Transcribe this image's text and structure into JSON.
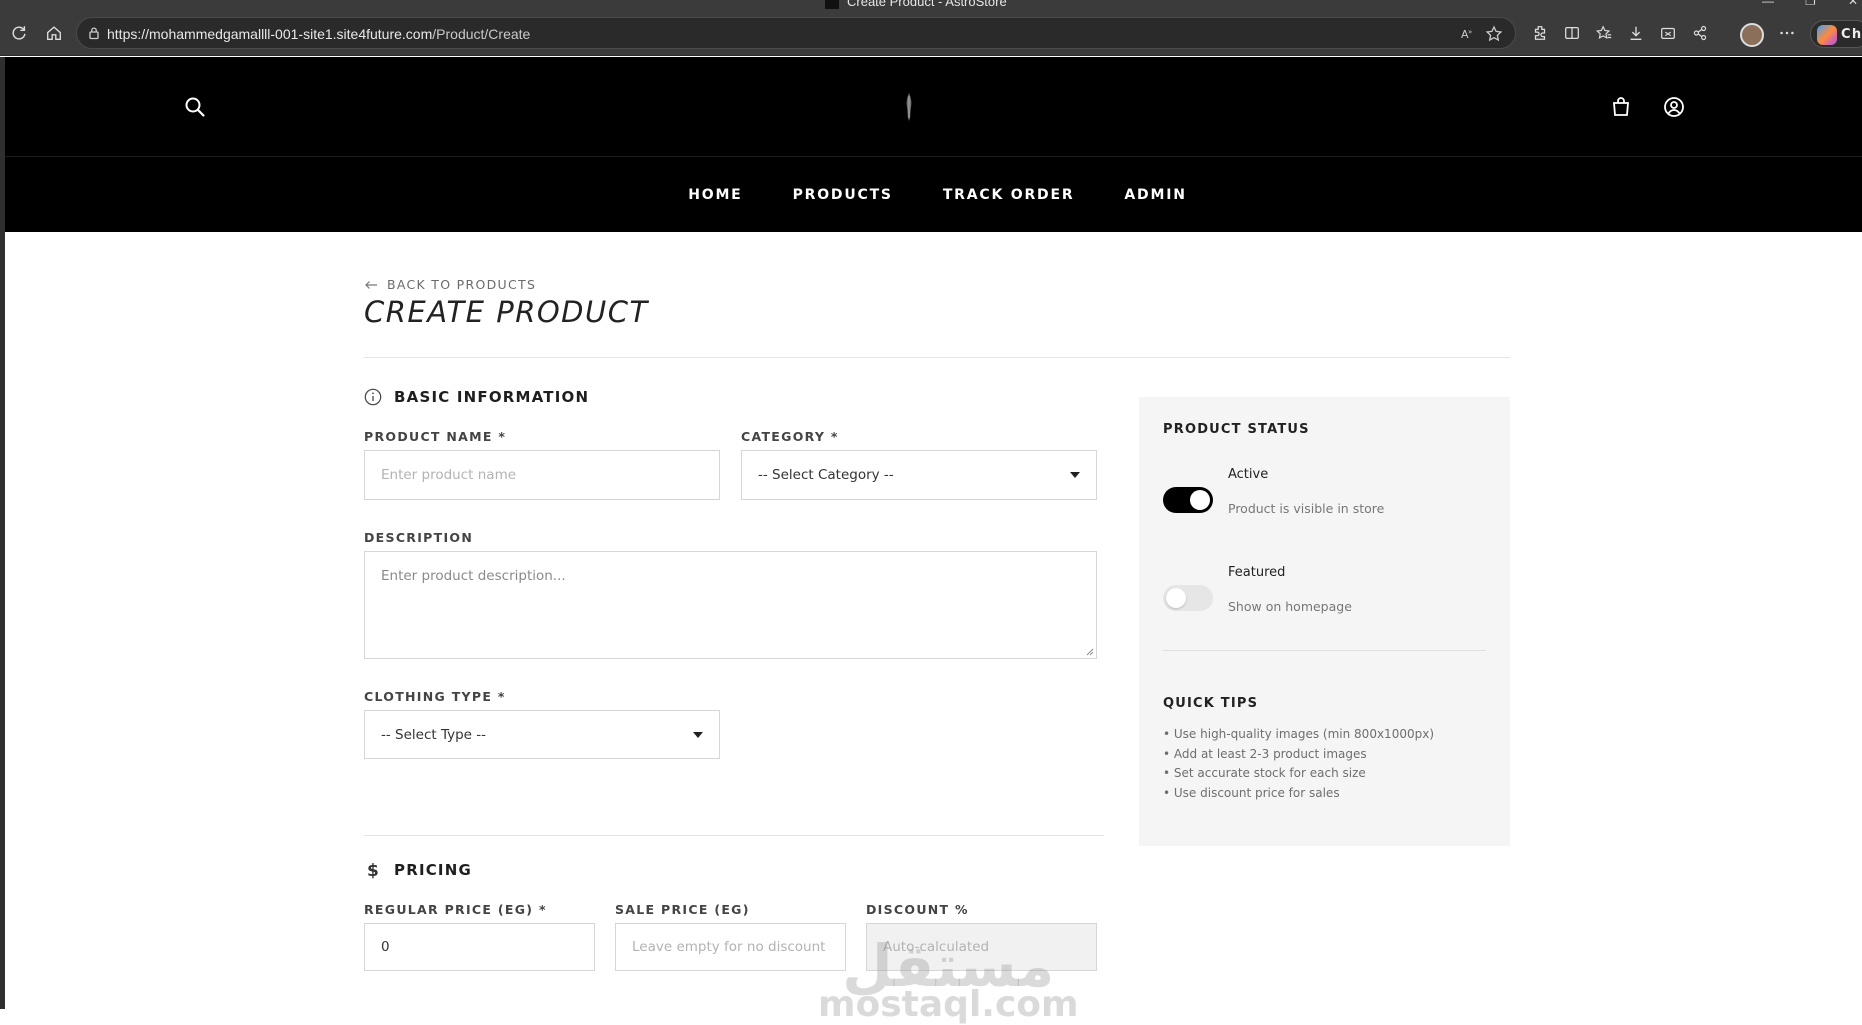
{
  "browser": {
    "window_title": "Create Product - AstroStore",
    "url_host": "https://mohammedgamallll-001-site1.site4future.com",
    "url_path": "/Product/Create",
    "copilot_label": "Cha"
  },
  "header": {
    "nav": [
      {
        "label": "HOME"
      },
      {
        "label": "PRODUCTS"
      },
      {
        "label": "TRACK ORDER"
      },
      {
        "label": "ADMIN"
      }
    ]
  },
  "page": {
    "back_label": "BACK TO PRODUCTS",
    "title": "CREATE PRODUCT"
  },
  "basic_info": {
    "heading": "BASIC INFORMATION",
    "product_name_label": "PRODUCT NAME *",
    "product_name_placeholder": "Enter product name",
    "category_label": "CATEGORY *",
    "category_selected": "-- Select Category --",
    "description_label": "DESCRIPTION",
    "description_placeholder": "Enter product description...",
    "clothing_type_label": "CLOTHING TYPE *",
    "clothing_type_selected": "-- Select Type --"
  },
  "pricing": {
    "heading": "PRICING",
    "regular_price_label": "REGULAR PRICE (EG) *",
    "regular_price_value": "0",
    "sale_price_label": "SALE PRICE (EG)",
    "sale_price_placeholder": "Leave empty for no discount",
    "discount_label": "DISCOUNT %",
    "discount_placeholder": "Auto-calculated"
  },
  "status_panel": {
    "heading": "PRODUCT STATUS",
    "active_title": "Active",
    "active_desc": "Product is visible in store",
    "active_on": true,
    "featured_title": "Featured",
    "featured_desc": "Show on homepage",
    "featured_on": false,
    "tips_heading": "QUICK TIPS",
    "tips": [
      "• Use high-quality images (min 800x1000px)",
      "• Add at least 2-3 product images",
      "• Set accurate stock for each size",
      "• Use discount price for sales"
    ]
  },
  "watermark": {
    "arabic": "مستقل",
    "latin": "mostaql.com"
  }
}
